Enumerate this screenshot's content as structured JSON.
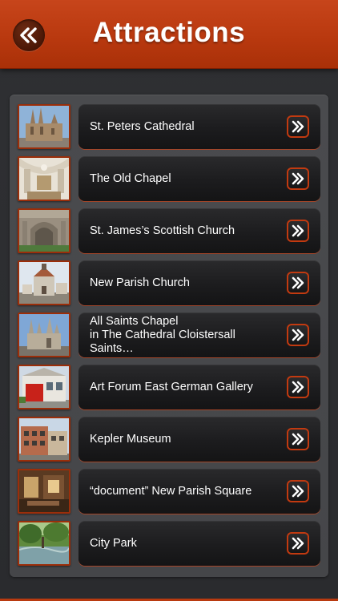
{
  "header": {
    "title": "Attractions",
    "back_icon": "double-chevron-left-icon",
    "color": "#c0401a"
  },
  "list": {
    "items": [
      {
        "label": "St. Peters Cathedral",
        "thumb": "cathedral-photo"
      },
      {
        "label": "The Old Chapel",
        "thumb": "chapel-interior-photo"
      },
      {
        "label": "St. James’s Scottish Church",
        "thumb": "church-portal-photo"
      },
      {
        "label": "New Parish Church",
        "thumb": "parish-church-photo"
      },
      {
        "label": "All Saints Chapel\nin The Cathedral Cloistersall Saints…",
        "thumb": "cathedral-spires-photo"
      },
      {
        "label": "Art Forum East German Gallery",
        "thumb": "gallery-building-photo"
      },
      {
        "label": "Kepler Museum",
        "thumb": "museum-building-photo"
      },
      {
        "label": "“document” New Parish Square",
        "thumb": "interior-photo"
      },
      {
        "label": "City Park",
        "thumb": "park-pond-photo"
      }
    ],
    "go_icon": "double-chevron-right-icon",
    "accent": "#c23a10"
  }
}
